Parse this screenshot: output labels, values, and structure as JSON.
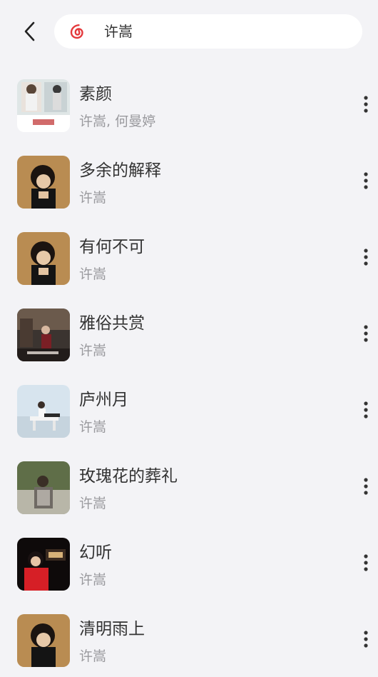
{
  "search": {
    "query": "许嵩",
    "logo_icon": "netease-cloud-music-icon",
    "accent_color": "#e4393c"
  },
  "songs": [
    {
      "title": "素颜",
      "artist": "许嵩, 何曼婷"
    },
    {
      "title": "多余的解释",
      "artist": "许嵩"
    },
    {
      "title": "有何不可",
      "artist": "许嵩"
    },
    {
      "title": "雅俗共赏",
      "artist": "许嵩"
    },
    {
      "title": "庐州月",
      "artist": "许嵩"
    },
    {
      "title": "玫瑰花的葬礼",
      "artist": "许嵩"
    },
    {
      "title": "幻听",
      "artist": "许嵩"
    },
    {
      "title": "清明雨上",
      "artist": "许嵩"
    }
  ]
}
